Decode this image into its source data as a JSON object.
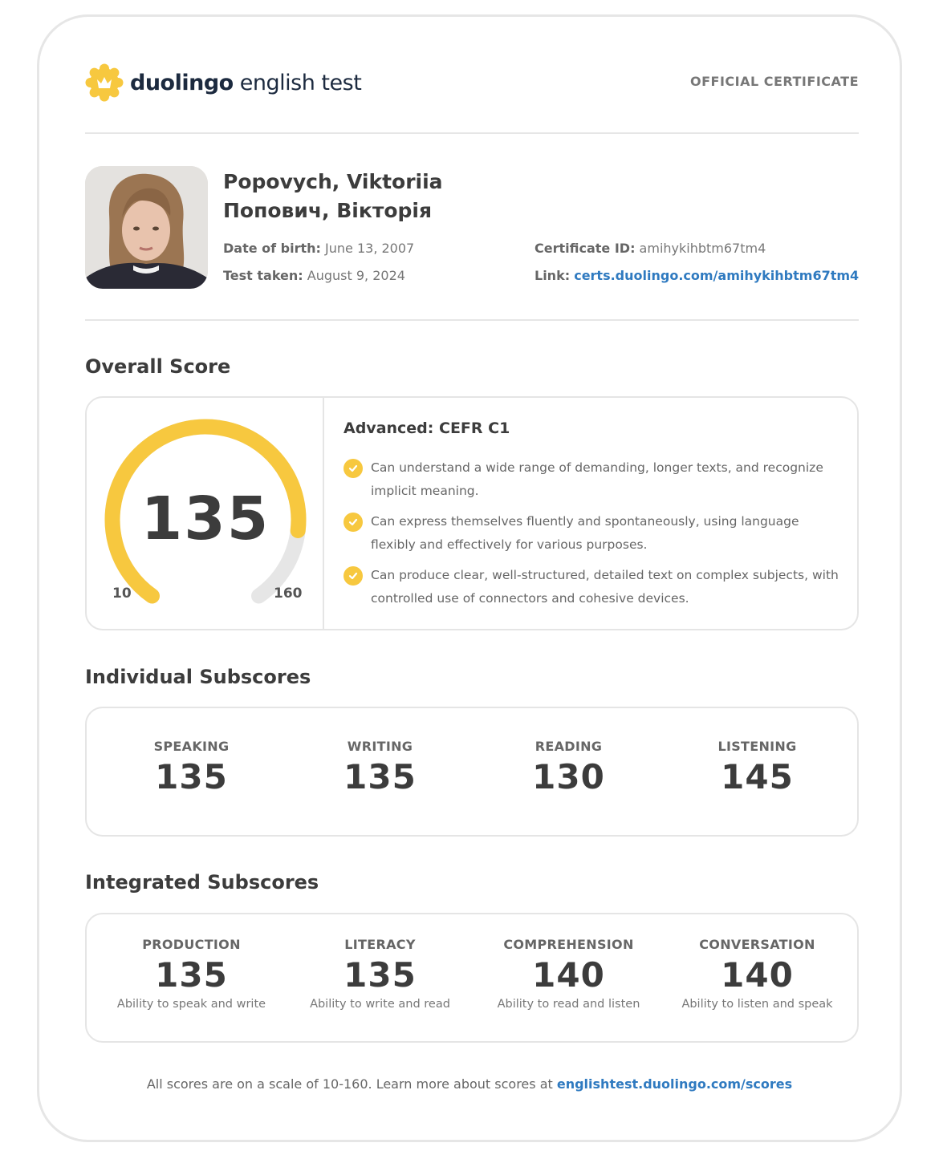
{
  "header": {
    "brand_bold": "duolingo",
    "brand_rest": " english test",
    "official": "OFFICIAL CERTIFICATE"
  },
  "profile": {
    "name_latin": "Popovych, Viktoriia",
    "name_cyrillic": "Попович, Вікторія",
    "dob_label": "Date of birth:",
    "dob_value": " June 13, 2007",
    "test_label": "Test taken:",
    "test_value": " August 9, 2024",
    "cert_label": "Certificate ID:",
    "cert_value": " amihykihbtm67tm4",
    "link_label": "Link:",
    "link_value": "certs.duolingo.com/amihykihbtm67tm4"
  },
  "overall": {
    "title": "Overall Score",
    "score": "135",
    "score_value": 135,
    "min": "10",
    "max": "160",
    "scale_min": 10,
    "scale_max": 160,
    "level": "Advanced: CEFR C1",
    "descriptors": [
      "Can understand a wide range of demanding, longer texts, and recognize implicit meaning.",
      "Can express themselves fluently and spontaneously, using language flexibly and effectively for various purposes.",
      "Can produce clear, well-structured, detailed text on complex subjects, with controlled use of connectors and cohesive devices."
    ]
  },
  "individual": {
    "title": "Individual Subscores",
    "items": [
      {
        "label": "SPEAKING",
        "value": "135"
      },
      {
        "label": "WRITING",
        "value": "135"
      },
      {
        "label": "READING",
        "value": "130"
      },
      {
        "label": "LISTENING",
        "value": "145"
      }
    ]
  },
  "integrated": {
    "title": "Integrated Subscores",
    "items": [
      {
        "label": "PRODUCTION",
        "value": "135",
        "desc": "Ability to speak and write"
      },
      {
        "label": "LITERACY",
        "value": "135",
        "desc": "Ability to write and read"
      },
      {
        "label": "COMPREHENSION",
        "value": "140",
        "desc": "Ability to read and listen"
      },
      {
        "label": "CONVERSATION",
        "value": "140",
        "desc": "Ability to listen and speak"
      }
    ]
  },
  "footer": {
    "text": "All scores are on a scale of 10-160. Learn more about scores at ",
    "link": "englishtest.duolingo.com/scores"
  },
  "colors": {
    "accent_yellow": "#f7c83f",
    "track_gray": "#e6e6e6",
    "link_blue": "#2f7ac0"
  }
}
